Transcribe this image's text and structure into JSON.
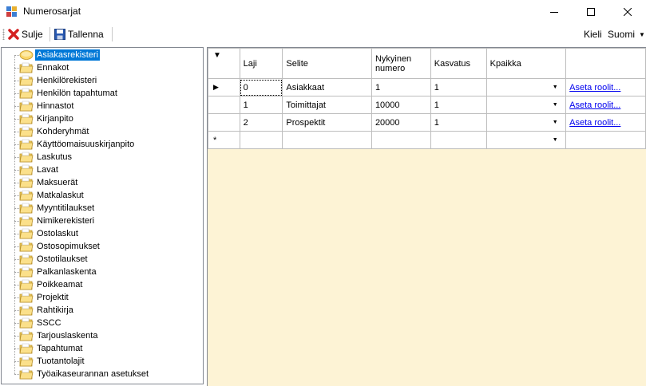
{
  "window": {
    "title": "Numerosarjat"
  },
  "toolbar": {
    "close_label": "Sulje",
    "save_label": "Tallenna",
    "language_label": "Kieli",
    "language_value": "Suomi"
  },
  "tree": {
    "items": [
      "Asiakasrekisteri",
      "Ennakot",
      "Henkilörekisteri",
      "Henkilön tapahtumat",
      "Hinnastot",
      "Kirjanpito",
      "Kohderyhmät",
      "Käyttöomaisuuskirjanpito",
      "Laskutus",
      "Lavat",
      "Maksuerät",
      "Matkalaskut",
      "Myyntitilaukset",
      "Nimikerekisteri",
      "Ostolaskut",
      "Ostosopimukset",
      "Ostotilaukset",
      "Palkanlaskenta",
      "Poikkeamat",
      "Projektit",
      "Rahtikirja",
      "SSCC",
      "Tarjouslaskenta",
      "Tapahtumat",
      "Tuotantolajit",
      "Työaikaseurannan asetukset"
    ],
    "selected_index": 0
  },
  "grid": {
    "columns": {
      "laji": "Laji",
      "selite": "Selite",
      "nykyinen_line1": "Nykyinen",
      "nykyinen_line2": "numero",
      "kasvatus": "Kasvatus",
      "kpaikka": "Kpaikka",
      "roolit": ""
    },
    "rows": [
      {
        "laji": "0",
        "selite": "Asiakkaat",
        "nykyinen": "1",
        "kasvatus": "1",
        "kpaikka": "",
        "roolit": "Aseta roolit..."
      },
      {
        "laji": "1",
        "selite": "Toimittajat",
        "nykyinen": "10000",
        "kasvatus": "1",
        "kpaikka": "",
        "roolit": "Aseta roolit..."
      },
      {
        "laji": "2",
        "selite": "Prospektit",
        "nykyinen": "20000",
        "kasvatus": "1",
        "kpaikka": "",
        "roolit": "Aseta roolit..."
      }
    ]
  },
  "colors": {
    "selection": "#0078d7",
    "grid_background": "#fdf3d5",
    "link": "#0000ee"
  }
}
